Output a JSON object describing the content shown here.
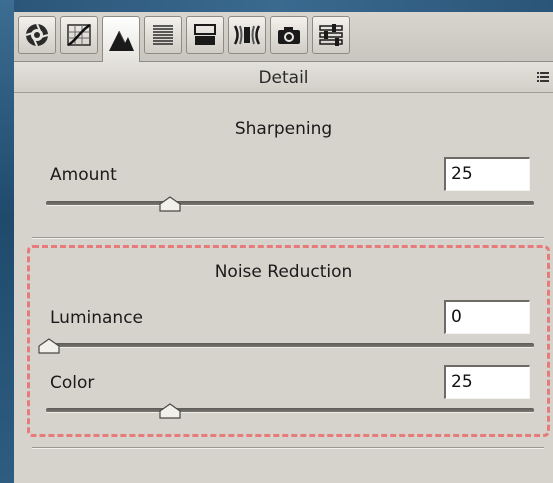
{
  "panel": {
    "title": "Detail",
    "menu_icon": "flyout-menu-icon",
    "tools": [
      {
        "icon": "aperture-icon",
        "name": "basic"
      },
      {
        "icon": "tone-curve-icon",
        "name": "tone-curve"
      },
      {
        "icon": "detail-triangles-icon",
        "name": "detail",
        "active": true
      },
      {
        "icon": "hsl-lines-icon",
        "name": "hsl"
      },
      {
        "icon": "split-toning-icon",
        "name": "split-toning"
      },
      {
        "icon": "lens-icon",
        "name": "lens-corrections"
      },
      {
        "icon": "camera-icon",
        "name": "camera-calibration"
      },
      {
        "icon": "sliders-icon",
        "name": "presets"
      }
    ]
  },
  "sharpening": {
    "title": "Sharpening",
    "amount": {
      "label": "Amount",
      "value": "25",
      "slider_fraction": 0.25
    }
  },
  "noise_reduction": {
    "title": "Noise Reduction",
    "luminance": {
      "label": "Luminance",
      "value": "0",
      "slider_fraction": 0.0
    },
    "color": {
      "label": "Color",
      "value": "25",
      "slider_fraction": 0.25
    }
  },
  "colors": {
    "panel_bg": "#d6d3cc",
    "highlight_dash": "#e77a7a",
    "desktop_bg": "#2a5273"
  }
}
